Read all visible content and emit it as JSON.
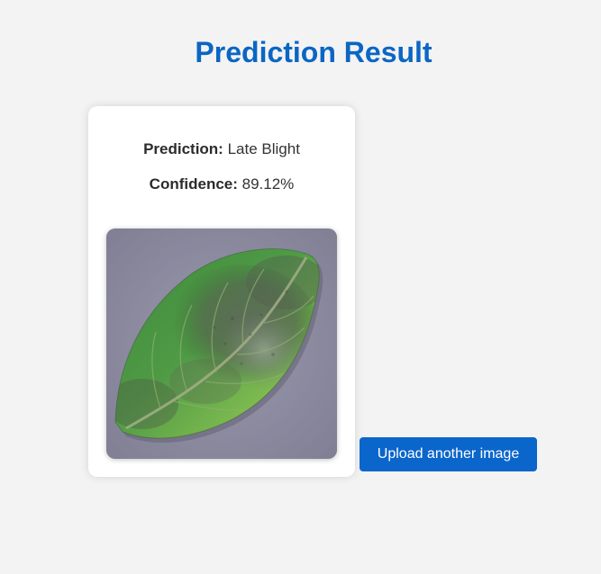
{
  "page": {
    "title": "Prediction Result"
  },
  "result": {
    "prediction_label": "Prediction:",
    "prediction_value": "Late Blight",
    "confidence_label": "Confidence:",
    "confidence_value": "89.12%"
  },
  "image": {
    "subject": "uploaded potato leaf photo"
  },
  "actions": {
    "upload_another_label": "Upload another image"
  },
  "colors": {
    "title": "#0b66c3",
    "button": "#0b66cc",
    "background": "#f3f3f3",
    "card": "#ffffff"
  }
}
